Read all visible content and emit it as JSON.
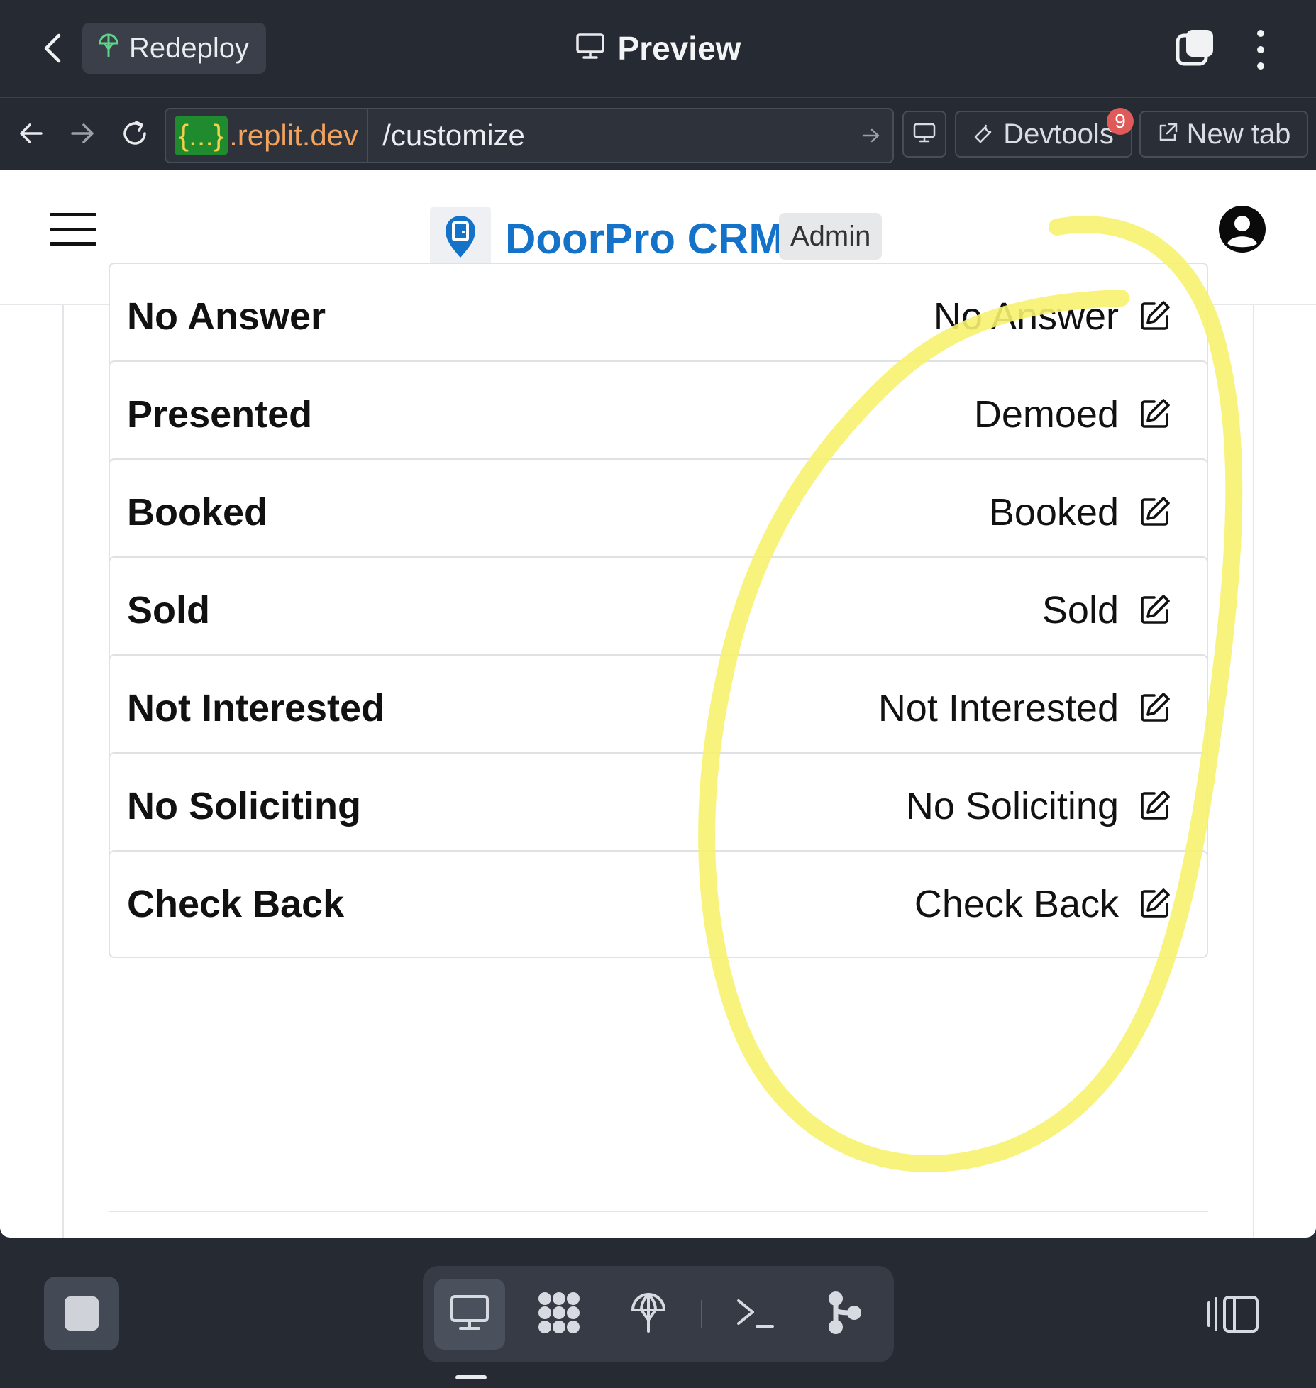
{
  "topbar": {
    "redeploy_label": "Redeploy",
    "title": "Preview"
  },
  "urlbar": {
    "domain_placeholder": "{...}",
    "domain_host": ".replit.dev",
    "path": "/customize",
    "devtools_label": "Devtools",
    "devtools_badge": "9",
    "new_tab_label": "New tab"
  },
  "site": {
    "brand": "DoorPro CRM",
    "role_badge": "Admin",
    "brand_color": "#1473c8"
  },
  "statuses": [
    {
      "name": "No Answer",
      "label": "No Answer"
    },
    {
      "name": "Presented",
      "label": "Demoed"
    },
    {
      "name": "Booked",
      "label": "Booked"
    },
    {
      "name": "Sold",
      "label": "Sold"
    },
    {
      "name": "Not Interested",
      "label": "Not Interested"
    },
    {
      "name": "No Soliciting",
      "label": "No Soliciting"
    },
    {
      "name": "Check Back",
      "label": "Check Back"
    }
  ],
  "annotation": {
    "highlight_color": "#f7f26e"
  },
  "bottombar": {
    "tools": [
      "preview-icon",
      "workspace-icon",
      "deploy-icon",
      "shell-icon",
      "git-icon"
    ]
  }
}
